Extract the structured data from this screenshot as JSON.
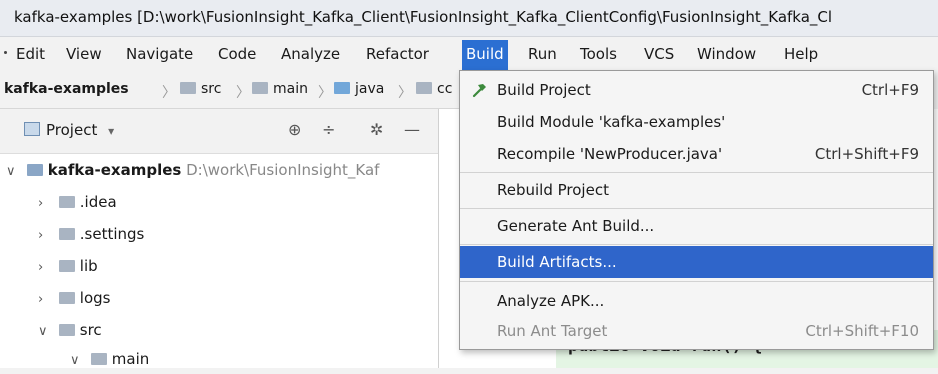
{
  "window": {
    "title": "kafka-examples [D:\\work\\FusionInsight_Kafka_Client\\FusionInsight_Kafka_ClientConfig\\FusionInsight_Kafka_Cl"
  },
  "menubar": {
    "items": [
      "Edit",
      "View",
      "Navigate",
      "Code",
      "Analyze",
      "Refactor",
      "Build",
      "Run",
      "Tools",
      "VCS",
      "Window",
      "Help"
    ],
    "active": "Build"
  },
  "breadcrumb": {
    "project": "kafka-examples",
    "items": [
      "src",
      "main",
      "java",
      "cc"
    ]
  },
  "project_panel": {
    "title": "Project",
    "dropdown_glyph": "▾"
  },
  "tree": {
    "root_name": "kafka-examples",
    "root_path": "D:\\work\\FusionInsight_Kaf",
    "items": [
      {
        "label": ".idea",
        "expanded": false
      },
      {
        "label": ".settings",
        "expanded": false
      },
      {
        "label": "lib",
        "expanded": false
      },
      {
        "label": "logs",
        "expanded": false
      },
      {
        "label": "src",
        "expanded": true
      },
      {
        "label": "main",
        "expanded": true
      }
    ]
  },
  "build_menu": {
    "items": [
      {
        "label": "Build Project",
        "shortcut": "Ctrl+F9",
        "icon": "hammer-icon"
      },
      {
        "label": "Build Module 'kafka-examples'",
        "shortcut": ""
      },
      {
        "label": "Recompile 'NewProducer.java'",
        "shortcut": "Ctrl+Shift+F9"
      },
      {
        "label": "Rebuild Project",
        "shortcut": ""
      },
      {
        "label": "Generate Ant Build...",
        "shortcut": ""
      },
      {
        "label": "Build Artifacts...",
        "shortcut": "",
        "selected": true
      },
      {
        "label": "Analyze APK...",
        "shortcut": ""
      },
      {
        "label": "Run Ant Target",
        "shortcut": "Ctrl+Shift+F10",
        "disabled": true
      }
    ]
  },
  "editor": {
    "visible_code": "public void run() {"
  },
  "colors": {
    "menu_active": "#2b6fd2",
    "menu_selected": "#2f65ca",
    "editor_highlight": "#e4f5e4"
  }
}
